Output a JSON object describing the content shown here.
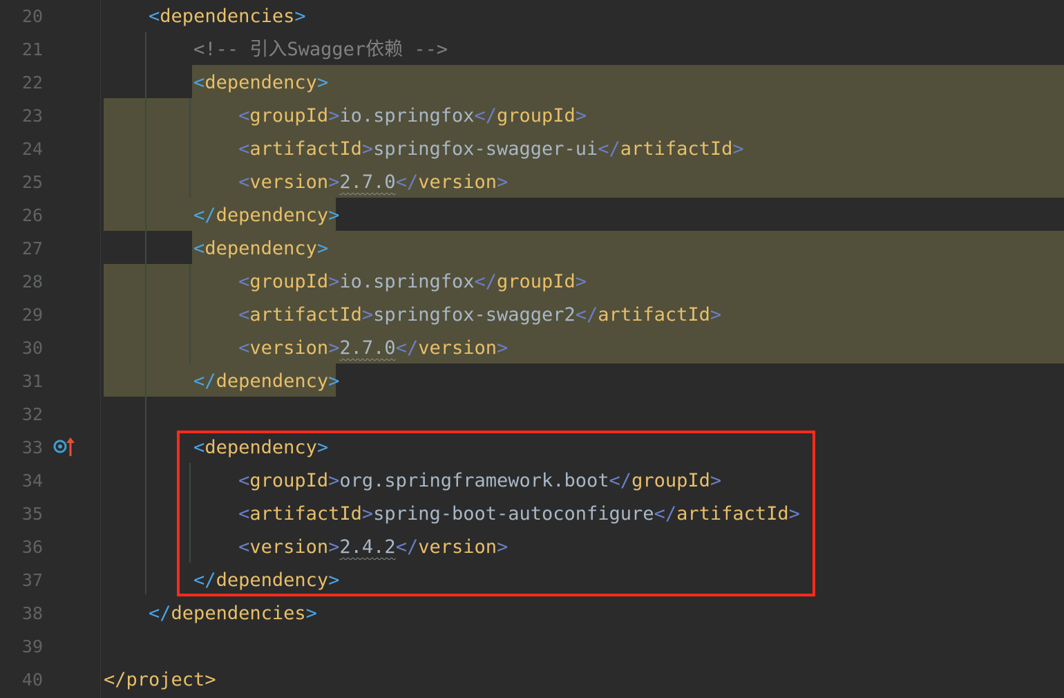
{
  "gutter": {
    "line_numbers": [
      "20",
      "21",
      "22",
      "23",
      "24",
      "25",
      "26",
      "27",
      "28",
      "29",
      "30",
      "31",
      "32",
      "33",
      "34",
      "35",
      "36",
      "37",
      "38",
      "39",
      "40"
    ],
    "icons": [
      "spring-bean-target-icon",
      "navigate-up-arrow-icon"
    ]
  },
  "code": {
    "l20": {
      "open": "<",
      "name": "dependencies",
      "close": ">"
    },
    "l21": {
      "comment": "<!-- 引入Swagger依赖 -->"
    },
    "l22": {
      "open": "<",
      "name": "dependency",
      "close": ">"
    },
    "l23": {
      "open": "<",
      "name": "groupId",
      "close": ">",
      "value": "io.springfox",
      "end_open": "</",
      "end_name": "groupId",
      "end_close": ">"
    },
    "l24": {
      "open": "<",
      "name": "artifactId",
      "close": ">",
      "value": "springfox-swagger-ui",
      "end_open": "</",
      "end_name": "artifactId",
      "end_close": ">"
    },
    "l25": {
      "open": "<",
      "name": "version",
      "close": ">",
      "value": "2.7.0",
      "end_open": "</",
      "end_name": "version",
      "end_close": ">"
    },
    "l26": {
      "open": "</",
      "name": "dependency",
      "close": ">"
    },
    "l27": {
      "open": "<",
      "name": "dependency",
      "close": ">"
    },
    "l28": {
      "open": "<",
      "name": "groupId",
      "close": ">",
      "value": "io.springfox",
      "end_open": "</",
      "end_name": "groupId",
      "end_close": ">"
    },
    "l29": {
      "open": "<",
      "name": "artifactId",
      "close": ">",
      "value": "springfox-swagger2",
      "end_open": "</",
      "end_name": "artifactId",
      "end_close": ">"
    },
    "l30": {
      "open": "<",
      "name": "version",
      "close": ">",
      "value": "2.7.0",
      "end_open": "</",
      "end_name": "version",
      "end_close": ">"
    },
    "l31": {
      "open": "</",
      "name": "dependency",
      "close": ">"
    },
    "l33": {
      "open": "<",
      "name": "dependency",
      "close": ">"
    },
    "l34": {
      "open": "<",
      "name": "groupId",
      "close": ">",
      "value": "org.springframework.boot",
      "end_open": "</",
      "end_name": "groupId",
      "end_close": ">"
    },
    "l35": {
      "open": "<",
      "name": "artifactId",
      "close": ">",
      "value": "spring-boot-autoconfigure",
      "end_open": "</",
      "end_name": "artifactId",
      "end_close": ">"
    },
    "l36": {
      "open": "<",
      "name": "version",
      "close": ">",
      "value": "2.4.2",
      "end_open": "</",
      "end_name": "version",
      "end_close": ">"
    },
    "l37": {
      "open": "</",
      "name": "dependency",
      "close": ">"
    },
    "l38": {
      "open": "</",
      "name": "dependencies",
      "close": ">"
    },
    "l40": {
      "open": "</",
      "name": "project",
      "close": ">"
    }
  },
  "colors": {
    "background": "#2b2b2b",
    "line_number": "#606366",
    "tag_name": "#e8bf6a",
    "bracket": "#4aa4e8",
    "text": "#a9b7c6",
    "comment": "#808080",
    "selection_highlight": "#52503a",
    "annotation_box": "#ff2a1a"
  }
}
